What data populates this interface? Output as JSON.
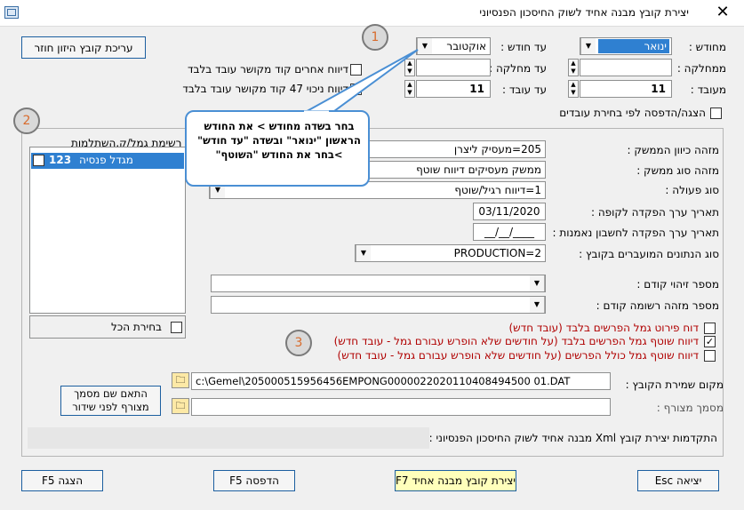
{
  "window": {
    "title": "יצירת קובץ מבנה אחיד לשוק החיסכון הפנסיוני",
    "close": "✕"
  },
  "top": {
    "from_month_label": "מחודש :",
    "from_month_value": "ינואר",
    "to_month_label": "עד חודש :",
    "to_month_value": "אוקטובר",
    "from_dept_label": "ממחלקה :",
    "to_dept_label": "עד מחלקה :",
    "from_emp_label": "מעובד :",
    "from_emp_value": "11",
    "to_emp_label": "עד עובד :",
    "to_emp_value": "11",
    "chk_other_reports": "דיווח אחרים קוד מקושר עובד בלבד",
    "chk_deduct_47_a": "דיווח ניכוי 47 קוד מקושר עובד בלבד",
    "chk_deduct_47_b": "יווח ניכוי 47 קוד מקושר עובד בלבד",
    "chk_show_print": "הצגה/הדפסה לפי בחירת עובדים",
    "edit_return_btn": "עריכת קובץ היזון חוזר"
  },
  "callout": {
    "text": "בחר בשדה מחודש > את החודש הראשון \"ינואר\" ובשדה \"עד חודש\" >בחר את החודש \"השוטף\""
  },
  "badges": {
    "one": "1",
    "two": "2",
    "three": "3"
  },
  "funds": {
    "title": "רשימת גמל/ק.השתלמות",
    "items": [
      {
        "number": "123",
        "name": "מגדל פנסיה",
        "checked": true
      }
    ],
    "select_all": "בחירת הכל"
  },
  "form": {
    "employer_dir_label": "מזהה כיוון הממשק :",
    "employer_dir_value": "205=מעסיק ליצרן",
    "interface_type_label": "מזהה סוג ממשק :",
    "interface_type_value": "ממשק מעסיקים דיווח שוטף",
    "action_type_label": "סוג פעולה :",
    "action_type_value": "1=דיווח רגיל/שוטף",
    "deposit_date_label": "תאריך ערך הפקדה לקופה :",
    "deposit_date_value": "03/11/2020",
    "trust_date_label": "תאריך ערך הפקדה לחשבון נאמנות :",
    "trust_date_value": "__/__/____",
    "data_type_label": "סוג הנתונים המועברים בקובץ :",
    "data_type_value": "PRODUCTION=2",
    "prev_id_label": "מספר זיהוי קודם :",
    "prev_record_label": "מספר מזהה רשומה קודם :"
  },
  "options": {
    "opt1": "דוח פירוט גמל הפרשים בלבד (עובד חדש)",
    "opt2": "דיווח שוטף גמל הפרשים בלבד (על חודשים שלא הופרש עבורם גמל - עובד חדש)",
    "opt3": "דיווח שוטף גמל כולל הפרשים (על חודשים שלא הופרש עבורם גמל - עובד חדש)"
  },
  "files": {
    "save_path_label": "מקום שמירת הקובץ :",
    "save_path_value": "c:\\Gemel\\205000515956456EMPONG0000022020110408494500 01.DAT",
    "attach_label": "מסמך מצורף :",
    "attach_btn_line1": "התאם שם מסמך",
    "attach_btn_line2": "מצורף לפני שידור"
  },
  "progress": {
    "label": "התקדמות יצירת קובץ Xml מבנה אחיד לשוק החיסכון הפנסיוני :"
  },
  "bottom": {
    "exit": "יציאה Esc",
    "create": "יצירת קובץ מבנה אחיד F7",
    "print": "הדפסה F5",
    "show": "הצגה F5"
  }
}
